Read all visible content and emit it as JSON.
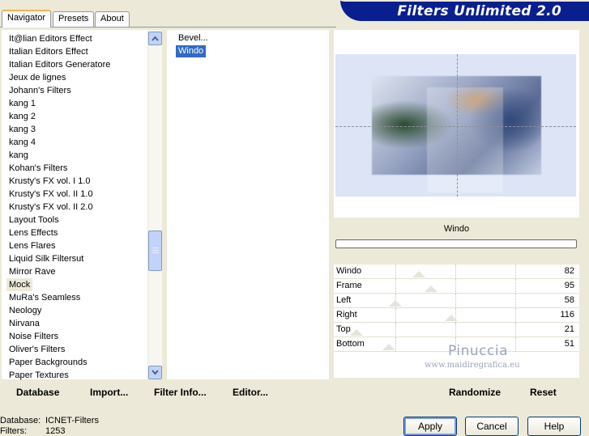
{
  "tabs": [
    "Navigator",
    "Presets",
    "About"
  ],
  "app_title": "Filters Unlimited 2.0",
  "categories": [
    "It@lian Editors Effect",
    "Italian Editors Effect",
    "Italian Editors Generatore",
    "Jeux de lignes",
    "Johann's Filters",
    "kang 1",
    "kang 2",
    "kang 3",
    "kang 4",
    "kang",
    "Kohan's Filters",
    "Krusty's FX vol. I 1.0",
    "Krusty's FX vol. II 1.0",
    "Krusty's FX vol. II 2.0",
    "Layout Tools",
    "Lens Effects",
    "Lens Flares",
    "Liquid Silk Filtersut",
    "Mirror Rave",
    "Mock",
    "MuRa's Seamless",
    "Neology",
    "Nirvana",
    "Noise Filters",
    "Oliver's Filters",
    "Paper Backgrounds",
    "Paper Textures"
  ],
  "selected_category": "Mock",
  "filters": [
    "Bevel...",
    "Windo"
  ],
  "selected_filter": "Windo",
  "current_filter_name": "Windo",
  "params": [
    {
      "label": "Windo",
      "value": "82"
    },
    {
      "label": "Frame",
      "value": "95"
    },
    {
      "label": "Left",
      "value": "58"
    },
    {
      "label": "Right",
      "value": "116"
    },
    {
      "label": "Top",
      "value": "21"
    },
    {
      "label": "Bottom",
      "value": "51"
    }
  ],
  "watermark": {
    "name": "Pinuccia",
    "url": "www.maidiregrafica.eu"
  },
  "toolbar_left": {
    "database": "Database",
    "import": "Import...",
    "filter_info": "Filter Info...",
    "editor": "Editor..."
  },
  "toolbar_right": {
    "randomize": "Randomize",
    "reset": "Reset"
  },
  "status": {
    "database_label": "Database:",
    "database_value": "ICNET-Filters",
    "filters_label": "Filters:",
    "filters_value": "1253"
  },
  "buttons": {
    "apply": "Apply",
    "cancel": "Cancel",
    "help": "Help"
  },
  "colors": {
    "accent": "#316ac5",
    "banner": "#0a1f8f",
    "background": "#ece9d8"
  }
}
